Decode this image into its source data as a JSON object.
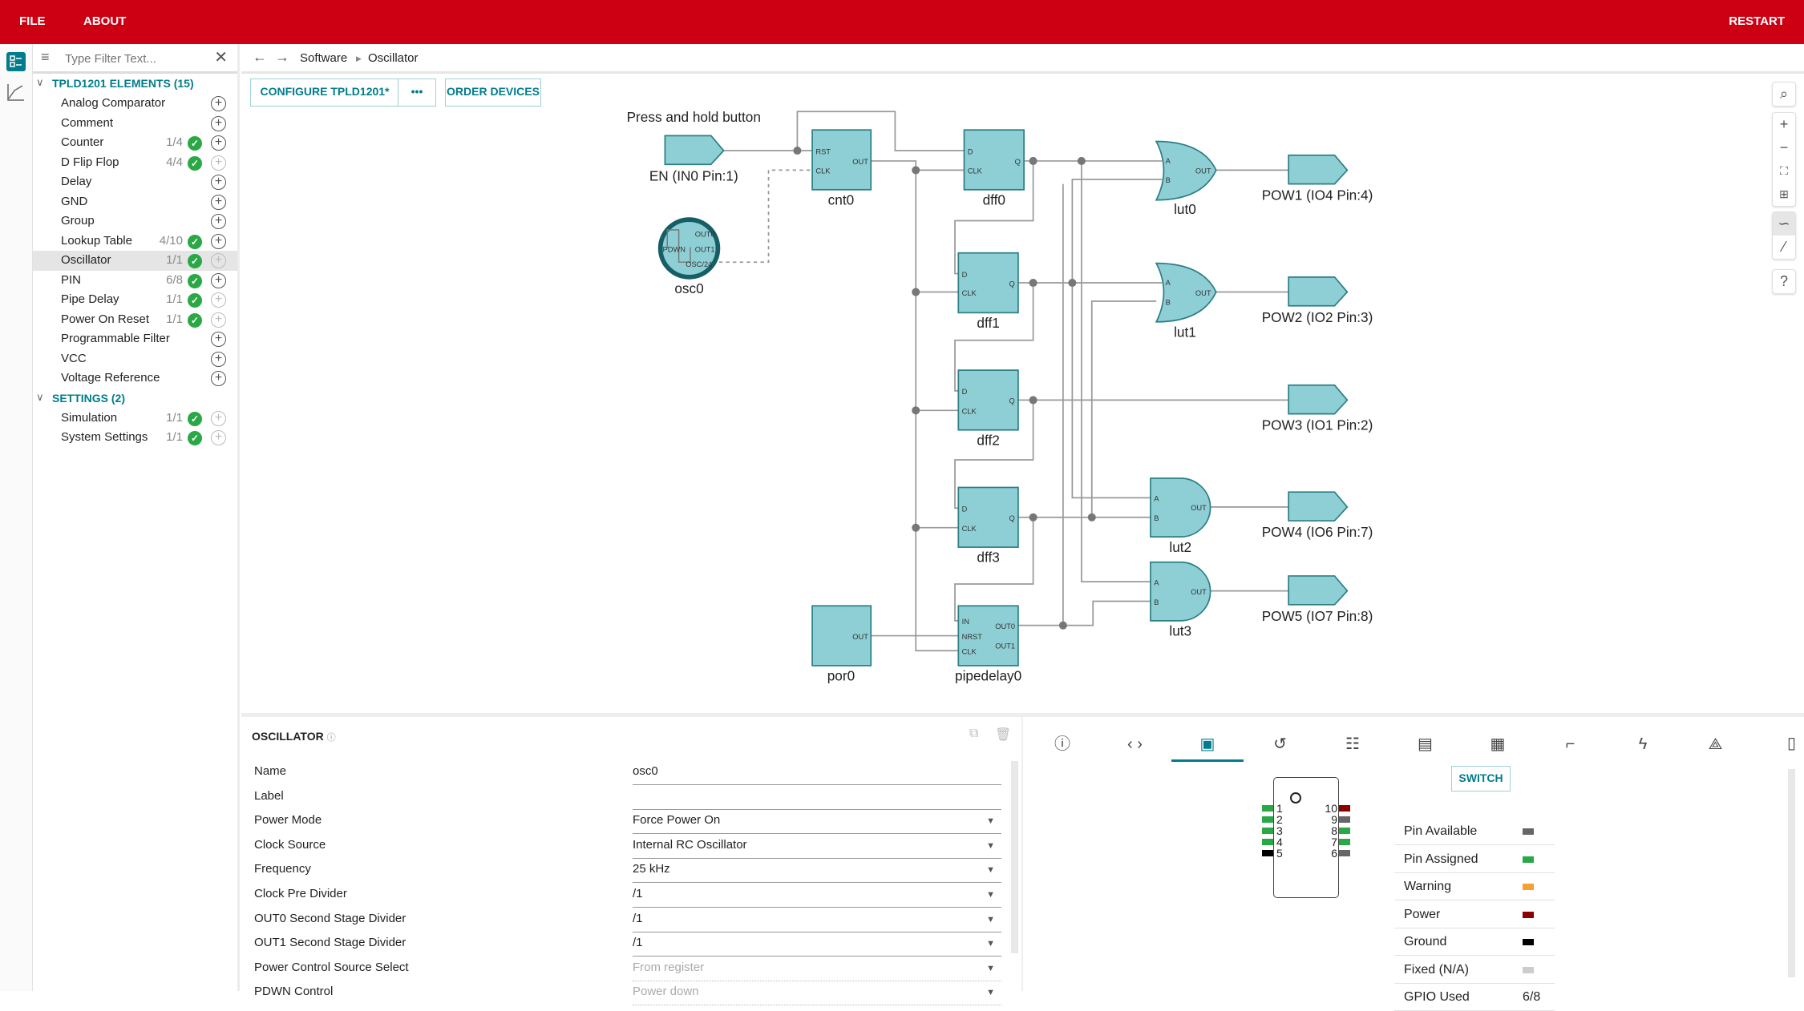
{
  "menu": {
    "file": "FILE",
    "about": "ABOUT",
    "restart": "RESTART"
  },
  "colors": {
    "brand": "#cc0012",
    "accent": "#007c8c",
    "block": "#8ecfd5",
    "ok": "#2aa845"
  },
  "sidebar": {
    "filter_placeholder": "Type Filter Text...",
    "elements_header": "TPLD1201 ELEMENTS (15)",
    "items": [
      {
        "name": "Analog Comparator",
        "count": "",
        "ok": false,
        "add": true
      },
      {
        "name": "Comment",
        "count": "",
        "ok": false,
        "add": true
      },
      {
        "name": "Counter",
        "count": "1/4",
        "ok": true,
        "add": true
      },
      {
        "name": "D Flip Flop",
        "count": "4/4",
        "ok": true,
        "add": false
      },
      {
        "name": "Delay",
        "count": "",
        "ok": false,
        "add": true
      },
      {
        "name": "GND",
        "count": "",
        "ok": false,
        "add": true
      },
      {
        "name": "Group",
        "count": "",
        "ok": false,
        "add": true
      },
      {
        "name": "Lookup Table",
        "count": "4/10",
        "ok": true,
        "add": true
      },
      {
        "name": "Oscillator",
        "count": "1/1",
        "ok": true,
        "add": false,
        "selected": true
      },
      {
        "name": "PIN",
        "count": "6/8",
        "ok": true,
        "add": true
      },
      {
        "name": "Pipe Delay",
        "count": "1/1",
        "ok": true,
        "add": false
      },
      {
        "name": "Power On Reset",
        "count": "1/1",
        "ok": true,
        "add": false
      },
      {
        "name": "Programmable Filter",
        "count": "",
        "ok": false,
        "add": true
      },
      {
        "name": "VCC",
        "count": "",
        "ok": false,
        "add": true
      },
      {
        "name": "Voltage Reference",
        "count": "",
        "ok": false,
        "add": true
      }
    ],
    "settings_header": "SETTINGS (2)",
    "settings": [
      {
        "name": "Simulation",
        "count": "1/1",
        "ok": true,
        "add": false
      },
      {
        "name": "System Settings",
        "count": "1/1",
        "ok": true,
        "add": false
      }
    ]
  },
  "breadcrumb": [
    "Software",
    "Oscillator"
  ],
  "toolbar": {
    "configure": "CONFIGURE TPLD1201*",
    "more": "•••",
    "order": "ORDER DEVICES"
  },
  "schematic": {
    "note": "Press and hold button",
    "en": "EN (IN0 Pin:1)",
    "osc": {
      "name": "osc0",
      "pdwn": "PDWN",
      "out0": "OUT0",
      "out1": "OUT1",
      "osc24": "OSC/24"
    },
    "cnt0": {
      "name": "cnt0",
      "rst": "RST",
      "clk": "CLK",
      "out": "OUT"
    },
    "dff": [
      {
        "name": "dff0"
      },
      {
        "name": "dff1"
      },
      {
        "name": "dff2"
      },
      {
        "name": "dff3"
      }
    ],
    "pin_d": "D",
    "pin_clk": "CLK",
    "pin_q": "Q",
    "pin_a": "A",
    "pin_b": "B",
    "pin_out": "OUT",
    "luts": [
      "lut0",
      "lut1",
      "lut2",
      "lut3"
    ],
    "por": {
      "name": "por0",
      "out": "OUT"
    },
    "pipedelay": {
      "name": "pipedelay0",
      "in": "IN",
      "nrst": "NRST",
      "clk": "CLK",
      "out0": "OUT0",
      "out1": "OUT1"
    },
    "outputs": [
      "POW1 (IO4 Pin:4)",
      "POW2 (IO2 Pin:3)",
      "POW3 (IO1 Pin:2)",
      "POW4 (IO6 Pin:7)",
      "POW5 (IO7 Pin:8)"
    ]
  },
  "properties": {
    "title": "OSCILLATOR",
    "rows": [
      {
        "label": "Name",
        "value": "osc0",
        "dropdown": false
      },
      {
        "label": "Label",
        "value": "",
        "dropdown": false
      },
      {
        "label": "Power Mode",
        "value": "Force Power On",
        "dropdown": true
      },
      {
        "label": "Clock Source",
        "value": "Internal RC Oscillator",
        "dropdown": true
      },
      {
        "label": "Frequency",
        "value": "25 kHz",
        "dropdown": true
      },
      {
        "label": "Clock Pre Divider",
        "value": "/1",
        "dropdown": true
      },
      {
        "label": "OUT0 Second Stage Divider",
        "value": "/1",
        "dropdown": true
      },
      {
        "label": "OUT1 Second Stage Divider",
        "value": "/1",
        "dropdown": true
      },
      {
        "label": "Power Control Source Select",
        "value": "From register",
        "dropdown": true,
        "disabled": true
      },
      {
        "label": "PDWN Control",
        "value": "Power down",
        "dropdown": true,
        "disabled": true
      }
    ]
  },
  "right_panel": {
    "tabs": [
      "info-icon",
      "code-icon",
      "chip-icon",
      "history-icon",
      "sliders-icon",
      "document-icon",
      "package-icon",
      "waveform-icon",
      "lightning-icon",
      "graph-icon"
    ],
    "active_tab": 2,
    "switch": "SWITCH",
    "pins_left": [
      {
        "n": "1",
        "c": "#2aa845"
      },
      {
        "n": "2",
        "c": "#2aa845"
      },
      {
        "n": "3",
        "c": "#2aa845"
      },
      {
        "n": "4",
        "c": "#2aa845"
      },
      {
        "n": "5",
        "c": "#000000"
      }
    ],
    "pins_right": [
      {
        "n": "10",
        "c": "#8b0000"
      },
      {
        "n": "9",
        "c": "#666666"
      },
      {
        "n": "8",
        "c": "#2aa845"
      },
      {
        "n": "7",
        "c": "#2aa845"
      },
      {
        "n": "6",
        "c": "#666666"
      }
    ],
    "legend": [
      {
        "label": "Pin Available",
        "color": "#666666"
      },
      {
        "label": "Pin Assigned",
        "color": "#2aa845"
      },
      {
        "label": "Warning",
        "color": "#f5a030"
      },
      {
        "label": "Power",
        "color": "#8b0000"
      },
      {
        "label": "Ground",
        "color": "#000000"
      },
      {
        "label": "Fixed (N/A)",
        "color": "#cccccc"
      },
      {
        "label": "GPIO Used",
        "value": "6/8"
      }
    ]
  }
}
